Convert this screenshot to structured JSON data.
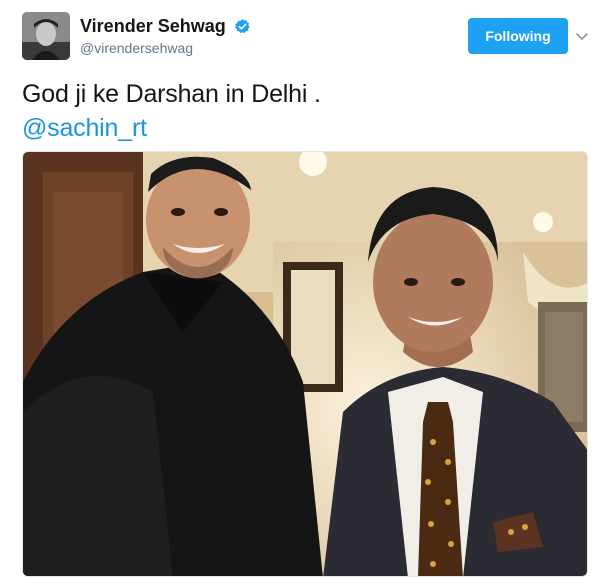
{
  "user": {
    "display_name": "Virender Sehwag",
    "handle": "@virendersehwag",
    "verified": true
  },
  "actions": {
    "follow_label": "Following"
  },
  "tweet": {
    "text": "God ji ke Darshan in Delhi .",
    "mention": "@sachin_rt"
  },
  "colors": {
    "accent": "#1da1f2",
    "mention": "#1b95e0",
    "handle": "#657786"
  }
}
